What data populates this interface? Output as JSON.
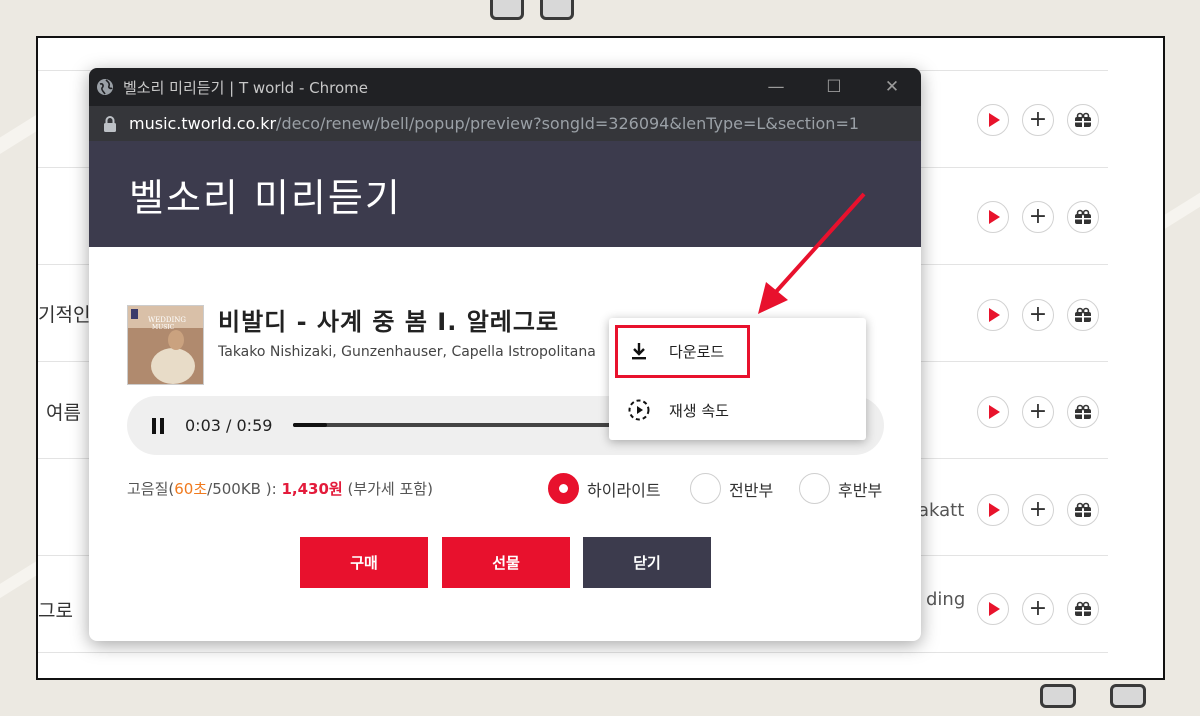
{
  "window": {
    "title": "벨소리 미리듣기 | T world - Chrome",
    "url_host": "music.tworld.co.kr",
    "url_path": "/deco/renew/bell/popup/preview?songId=326094&lenType=L&section=1",
    "minimize": "—",
    "maximize": "☐",
    "close": "✕"
  },
  "header": {
    "title": "벨소리 미리듣기"
  },
  "song": {
    "title": "비발디 - 사계 중 봄 I. 알레그로",
    "artist": "Takako Nishizaki, Gunzenhauser, Capella Istropolitana"
  },
  "player": {
    "time": "0:03 / 0:59",
    "progress_fraction": 0.066
  },
  "price": {
    "prefix": "고음질(",
    "seconds": "60초",
    "size": "/500KB ):",
    "amount": "1,430원",
    "vat": "(부가세 포함)"
  },
  "radios": [
    {
      "label": "하이라이트",
      "selected": true
    },
    {
      "label": "전반부",
      "selected": false
    },
    {
      "label": "후반부",
      "selected": false
    }
  ],
  "buttons": {
    "buy": "구매",
    "gift": "선물",
    "close": "닫기"
  },
  "context_menu": {
    "download": "다운로드",
    "speed": "재생 속도"
  },
  "background_list": {
    "left_texts": [
      "기적인",
      "여름",
      "그로"
    ],
    "right_texts": [
      "akatt",
      "ding"
    ]
  },
  "colors": {
    "accent_red": "#e8112d",
    "header_dark": "#3c3b4d",
    "chrome_bar": "#202124"
  },
  "icons": [
    "globe-icon",
    "lock-icon",
    "pause-icon",
    "download-icon",
    "playback-speed-icon",
    "play-icon",
    "plus-icon",
    "gift-icon"
  ]
}
